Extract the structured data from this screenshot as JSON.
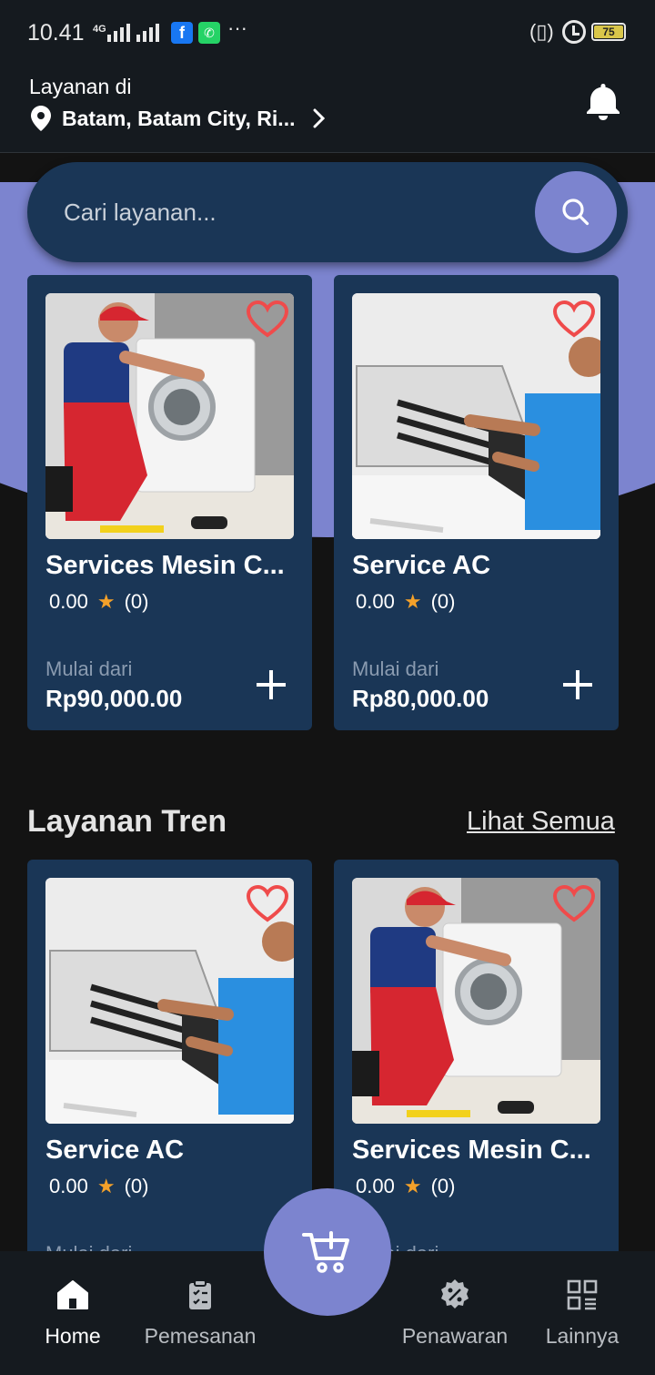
{
  "status_bar": {
    "time": "10.41",
    "network": "4G",
    "battery": "75"
  },
  "header": {
    "location_label": "Layanan di",
    "location_value": "Batam, Batam City, Ri..."
  },
  "search": {
    "placeholder": "Cari layanan..."
  },
  "featured_cards": [
    {
      "title": "Services Mesin C...",
      "rating": "0.00",
      "reviews": "(0)",
      "from_label": "Mulai dari",
      "price": "Rp90,000.00",
      "image": "washing-machine-repair"
    },
    {
      "title": "Service AC",
      "rating": "0.00",
      "reviews": "(0)",
      "from_label": "Mulai dari",
      "price": "Rp80,000.00",
      "image": "ac-repair"
    }
  ],
  "trending": {
    "title": "Layanan Tren",
    "see_all": "Lihat Semua",
    "cards": [
      {
        "title": "Service AC",
        "rating": "0.00",
        "reviews": "(0)",
        "from_label": "Mulai dari",
        "image": "ac-repair"
      },
      {
        "title": "Services Mesin C...",
        "rating": "0.00",
        "reviews": "(0)",
        "from_label": "Mulai dari",
        "image": "washing-machine-repair"
      }
    ]
  },
  "bottom_nav": {
    "items": [
      {
        "label": "Home",
        "icon": "home-icon",
        "active": true
      },
      {
        "label": "Pemesanan",
        "icon": "clipboard-icon",
        "active": false
      },
      {
        "label": "Penawaran",
        "icon": "discount-icon",
        "active": false
      },
      {
        "label": "Lainnya",
        "icon": "grid-list-icon",
        "active": false
      }
    ],
    "fab_icon": "cart-add-icon"
  },
  "colors": {
    "accent": "#7c84cf",
    "card": "#1a3656",
    "background": "#131313",
    "star": "#f4a12a",
    "heart": "#ef4b4b"
  }
}
